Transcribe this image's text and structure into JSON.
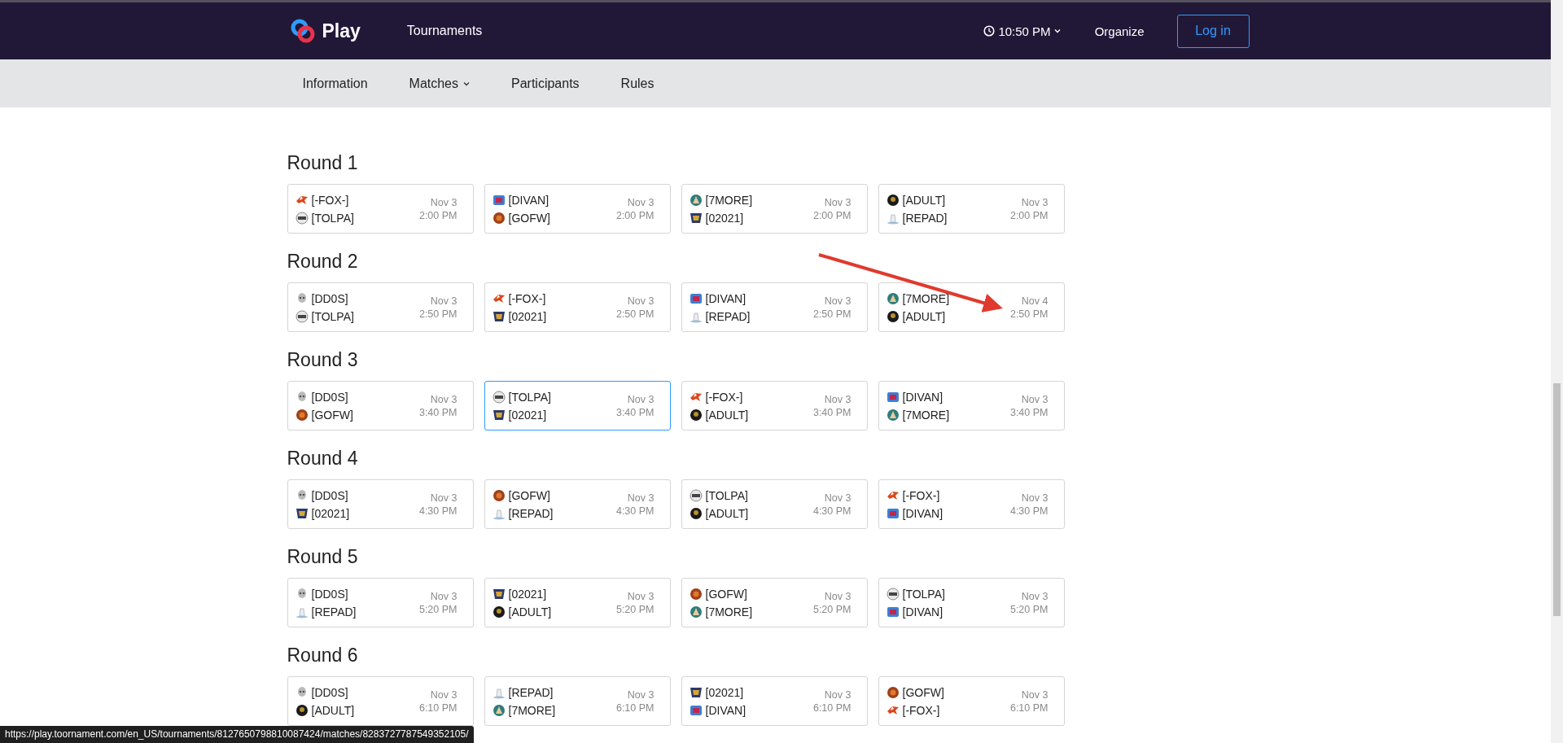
{
  "header": {
    "logo": "Play",
    "nav": [
      {
        "label": "Tournaments"
      }
    ],
    "clock": "10:50 PM",
    "organize": "Organize",
    "login": "Log in"
  },
  "subnav": [
    {
      "label": "Information",
      "kind": "link"
    },
    {
      "label": "Matches",
      "kind": "dropdown"
    },
    {
      "label": "Participants",
      "kind": "link"
    },
    {
      "label": "Rules",
      "kind": "link"
    }
  ],
  "rounds": [
    {
      "title": "Round 1",
      "matches": [
        {
          "selected": false,
          "teams": [
            {
              "name": "[-FOX-]",
              "kind": "fox"
            },
            {
              "name": "[TOLPA]",
              "kind": "tolpa"
            }
          ],
          "date": "Nov 3",
          "time": "2:00 PM"
        },
        {
          "selected": false,
          "teams": [
            {
              "name": "[DIVAN]",
              "kind": "divan"
            },
            {
              "name": "[GOFW]",
              "kind": "gofw"
            }
          ],
          "date": "Nov 3",
          "time": "2:00 PM"
        },
        {
          "selected": false,
          "teams": [
            {
              "name": "[7MORE]",
              "kind": "mountain"
            },
            {
              "name": "[02021]",
              "kind": "crest"
            }
          ],
          "date": "Nov 3",
          "time": "2:00 PM"
        },
        {
          "selected": false,
          "teams": [
            {
              "name": "[ADULT]",
              "kind": "adult"
            },
            {
              "name": "[REPAD]",
              "kind": "repad"
            }
          ],
          "date": "Nov 3",
          "time": "2:00 PM"
        }
      ]
    },
    {
      "title": "Round 2",
      "matches": [
        {
          "selected": false,
          "teams": [
            {
              "name": "[DD0S]",
              "kind": "skull"
            },
            {
              "name": "[TOLPA]",
              "kind": "tolpa"
            }
          ],
          "date": "Nov 3",
          "time": "2:50 PM"
        },
        {
          "selected": false,
          "teams": [
            {
              "name": "[-FOX-]",
              "kind": "fox"
            },
            {
              "name": "[02021]",
              "kind": "crest"
            }
          ],
          "date": "Nov 3",
          "time": "2:50 PM"
        },
        {
          "selected": false,
          "teams": [
            {
              "name": "[DIVAN]",
              "kind": "divan"
            },
            {
              "name": "[REPAD]",
              "kind": "repad"
            }
          ],
          "date": "Nov 3",
          "time": "2:50 PM"
        },
        {
          "selected": false,
          "teams": [
            {
              "name": "[7MORE]",
              "kind": "mountain"
            },
            {
              "name": "[ADULT]",
              "kind": "adult"
            }
          ],
          "date": "Nov 4",
          "time": "2:50 PM"
        }
      ]
    },
    {
      "title": "Round 3",
      "matches": [
        {
          "selected": false,
          "teams": [
            {
              "name": "[DD0S]",
              "kind": "skull"
            },
            {
              "name": "[GOFW]",
              "kind": "gofw"
            }
          ],
          "date": "Nov 3",
          "time": "3:40 PM"
        },
        {
          "selected": true,
          "teams": [
            {
              "name": "[TOLPA]",
              "kind": "tolpa"
            },
            {
              "name": "[02021]",
              "kind": "crest"
            }
          ],
          "date": "Nov 3",
          "time": "3:40 PM"
        },
        {
          "selected": false,
          "teams": [
            {
              "name": "[-FOX-]",
              "kind": "fox"
            },
            {
              "name": "[ADULT]",
              "kind": "adult"
            }
          ],
          "date": "Nov 3",
          "time": "3:40 PM"
        },
        {
          "selected": false,
          "teams": [
            {
              "name": "[DIVAN]",
              "kind": "divan"
            },
            {
              "name": "[7MORE]",
              "kind": "mountain"
            }
          ],
          "date": "Nov 3",
          "time": "3:40 PM"
        }
      ]
    },
    {
      "title": "Round 4",
      "matches": [
        {
          "selected": false,
          "teams": [
            {
              "name": "[DD0S]",
              "kind": "skull"
            },
            {
              "name": "[02021]",
              "kind": "crest"
            }
          ],
          "date": "Nov 3",
          "time": "4:30 PM"
        },
        {
          "selected": false,
          "teams": [
            {
              "name": "[GOFW]",
              "kind": "gofw"
            },
            {
              "name": "[REPAD]",
              "kind": "repad"
            }
          ],
          "date": "Nov 3",
          "time": "4:30 PM"
        },
        {
          "selected": false,
          "teams": [
            {
              "name": "[TOLPA]",
              "kind": "tolpa"
            },
            {
              "name": "[ADULT]",
              "kind": "adult"
            }
          ],
          "date": "Nov 3",
          "time": "4:30 PM"
        },
        {
          "selected": false,
          "teams": [
            {
              "name": "[-FOX-]",
              "kind": "fox"
            },
            {
              "name": "[DIVAN]",
              "kind": "divan"
            }
          ],
          "date": "Nov 3",
          "time": "4:30 PM"
        }
      ]
    },
    {
      "title": "Round 5",
      "matches": [
        {
          "selected": false,
          "teams": [
            {
              "name": "[DD0S]",
              "kind": "skull"
            },
            {
              "name": "[REPAD]",
              "kind": "repad"
            }
          ],
          "date": "Nov 3",
          "time": "5:20 PM"
        },
        {
          "selected": false,
          "teams": [
            {
              "name": "[02021]",
              "kind": "crest"
            },
            {
              "name": "[ADULT]",
              "kind": "adult"
            }
          ],
          "date": "Nov 3",
          "time": "5:20 PM"
        },
        {
          "selected": false,
          "teams": [
            {
              "name": "[GOFW]",
              "kind": "gofw"
            },
            {
              "name": "[7MORE]",
              "kind": "mountain"
            }
          ],
          "date": "Nov 3",
          "time": "5:20 PM"
        },
        {
          "selected": false,
          "teams": [
            {
              "name": "[TOLPA]",
              "kind": "tolpa"
            },
            {
              "name": "[DIVAN]",
              "kind": "divan"
            }
          ],
          "date": "Nov 3",
          "time": "5:20 PM"
        }
      ]
    },
    {
      "title": "Round 6",
      "matches": [
        {
          "selected": false,
          "teams": [
            {
              "name": "[DD0S]",
              "kind": "skull"
            },
            {
              "name": "[ADULT]",
              "kind": "adult"
            }
          ],
          "date": "Nov 3",
          "time": "6:10 PM"
        },
        {
          "selected": false,
          "teams": [
            {
              "name": "[REPAD]",
              "kind": "repad"
            },
            {
              "name": "[7MORE]",
              "kind": "mountain"
            }
          ],
          "date": "Nov 3",
          "time": "6:10 PM"
        },
        {
          "selected": false,
          "teams": [
            {
              "name": "[02021]",
              "kind": "crest"
            },
            {
              "name": "[DIVAN]",
              "kind": "divan"
            }
          ],
          "date": "Nov 3",
          "time": "6:10 PM"
        },
        {
          "selected": false,
          "teams": [
            {
              "name": "[GOFW]",
              "kind": "gofw"
            },
            {
              "name": "[-FOX-]",
              "kind": "fox"
            }
          ],
          "date": "Nov 3",
          "time": "6:10 PM"
        }
      ]
    }
  ],
  "status_bar": {
    "url": "https://play.toornament.com/en_US/tournaments/8127650798810087424/matches/8283727787549352105/"
  }
}
